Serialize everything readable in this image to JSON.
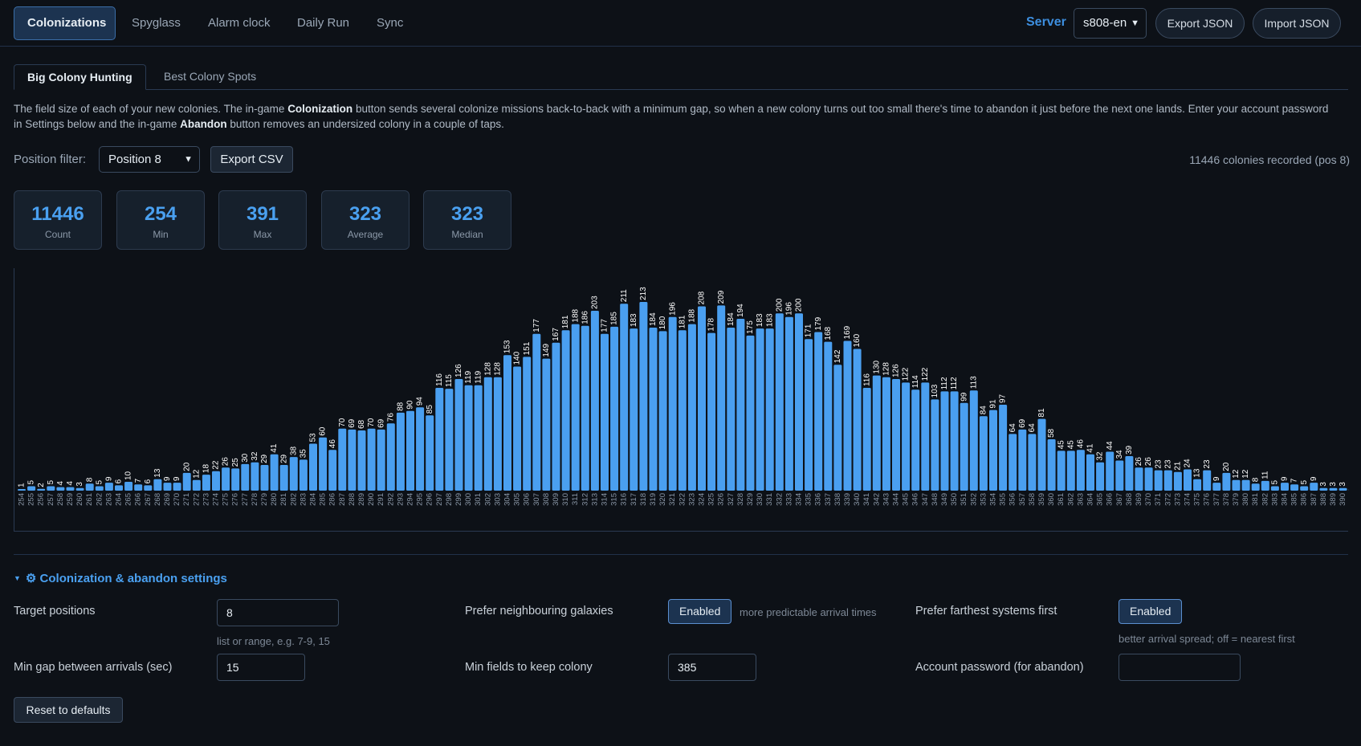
{
  "nav": {
    "tabs": [
      "Colonizations",
      "Spyglass",
      "Alarm clock",
      "Daily Run",
      "Sync"
    ],
    "active": "Colonizations",
    "server_label": "Server",
    "server_value": "s808-en",
    "export_json": "Export JSON",
    "import_json": "Import JSON"
  },
  "subtabs": [
    "Big Colony Hunting",
    "Best Colony Spots"
  ],
  "description": {
    "p1": "The field size of each of your new colonies. The in-game ",
    "b1": "Colonization",
    "p2": " button sends several colonize missions back-to-back with a minimum gap, so when a new colony turns out too small there's time to abandon it just before the next one lands. Enter your account password in Settings below and the in-game ",
    "b2": "Abandon",
    "p3": " button removes an undersized colony in a couple of taps."
  },
  "filter": {
    "label": "Position filter:",
    "value": "Position 8",
    "export_csv": "Export CSV",
    "recorded": "11446 colonies recorded (pos 8)"
  },
  "stats": [
    {
      "value": "11446",
      "label": "Count"
    },
    {
      "value": "254",
      "label": "Min"
    },
    {
      "value": "391",
      "label": "Max"
    },
    {
      "value": "323",
      "label": "Average"
    },
    {
      "value": "323",
      "label": "Median"
    }
  ],
  "chart_data": {
    "type": "bar",
    "bar_color": "#4a9ff0",
    "x_start": 254,
    "values": [
      1,
      5,
      2,
      5,
      4,
      4,
      3,
      8,
      5,
      9,
      6,
      10,
      7,
      6,
      13,
      9,
      9,
      20,
      12,
      18,
      22,
      26,
      25,
      30,
      32,
      29,
      41,
      29,
      38,
      35,
      53,
      60,
      46,
      70,
      69,
      68,
      70,
      69,
      76,
      88,
      90,
      94,
      85,
      116,
      115,
      126,
      119,
      119,
      128,
      128,
      153,
      140,
      151,
      177,
      149,
      167,
      181,
      188,
      186,
      203,
      177,
      185,
      211,
      183,
      213,
      184,
      180,
      196,
      181,
      188,
      208,
      178,
      209,
      184,
      194,
      175,
      183,
      183,
      200,
      196,
      200,
      171,
      179,
      168,
      142,
      169,
      160,
      116,
      130,
      128,
      126,
      122,
      114,
      122,
      103,
      112,
      112,
      99,
      113,
      84,
      91,
      97,
      64,
      69,
      64,
      81,
      58,
      45,
      45,
      46,
      41,
      32,
      44,
      34,
      39,
      26,
      26,
      23,
      23,
      21,
      24,
      13,
      23,
      9,
      20,
      12,
      12,
      8,
      11,
      5,
      9,
      7,
      5,
      9,
      3,
      3,
      3,
      1
    ],
    "ylim": [
      0,
      213
    ]
  },
  "settings": {
    "title": "⚙ Colonization & abandon settings",
    "target_positions_label": "Target positions",
    "target_positions_value": "8",
    "target_positions_hint": "list or range, e.g. 7-9, 15",
    "min_gap_label": "Min gap between arrivals (sec)",
    "min_gap_value": "15",
    "prefer_neighbour_label": "Prefer neighbouring galaxies",
    "prefer_neighbour_value": "Enabled",
    "prefer_neighbour_hint": "more predictable arrival times",
    "min_fields_label": "Min fields to keep colony",
    "min_fields_value": "385",
    "prefer_farthest_label": "Prefer farthest systems first",
    "prefer_farthest_value": "Enabled",
    "prefer_farthest_hint": "better arrival spread; off = nearest first",
    "password_label": "Account password (for abandon)",
    "password_value": "",
    "reset": "Reset to defaults"
  }
}
